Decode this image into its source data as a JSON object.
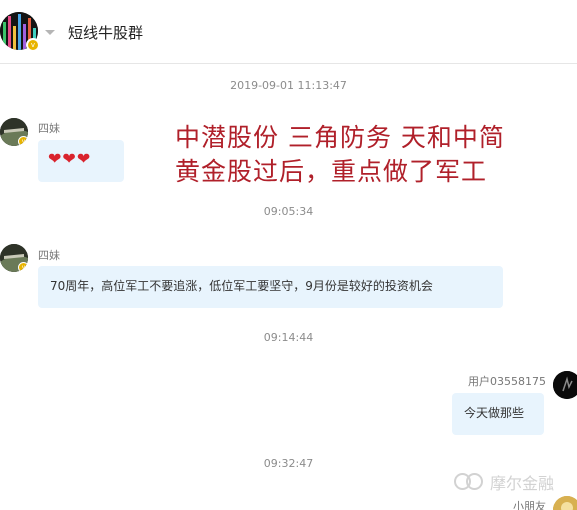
{
  "header": {
    "group_title": "短线牛股群",
    "avatar_icon": "group-avatar"
  },
  "colors": {
    "bubble": "#e8f4fd",
    "overlay_text": "#b0202a",
    "badge": "#e8b400"
  },
  "overlay": {
    "line1": "中潜股份 三角防务 天和中简",
    "line2": "黄金股过后，重点做了军工"
  },
  "timestamps": [
    "2019-09-01 11:13:47",
    "09:05:34",
    "09:14:44",
    "09:32:47"
  ],
  "messages": [
    {
      "sender": "四妹",
      "text": "❤❤❤"
    },
    {
      "sender": "四妹",
      "text": "70周年，高位军工不要追涨，低位军工要坚守，9月份是较好的投资机会"
    },
    {
      "sender": "用户03558175",
      "text": "今天做那些"
    },
    {
      "sender": "小朋友"
    }
  ],
  "watermark": "摩尔金融"
}
